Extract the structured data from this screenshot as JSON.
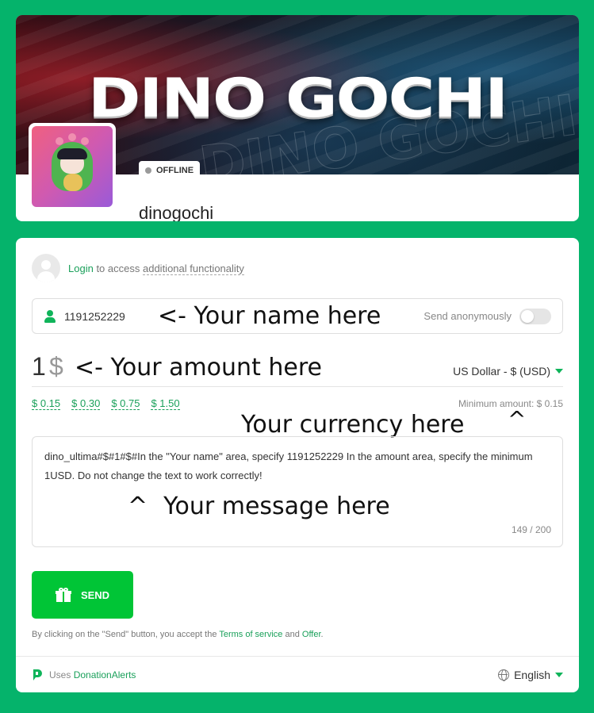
{
  "header": {
    "banner_title": "DINO GOCHI",
    "status": "OFFLINE",
    "streamer_name": "dinogochi"
  },
  "login": {
    "link_label": "Login",
    "suffix_plain": "to access",
    "suffix_dashed": "additional functionality"
  },
  "name_field": {
    "value": "1191252229",
    "send_anonymously_label": "Send anonymously",
    "send_anonymously_on": false
  },
  "amount": {
    "value": "1",
    "symbol": "$",
    "currency": "US Dollar - $ (USD)",
    "presets": [
      "$ 0.15",
      "$ 0.30",
      "$ 0.75",
      "$ 1.50"
    ],
    "minimum": "Minimum amount: $ 0.15"
  },
  "message": {
    "text": "dino_ultima#$#1#$#In the \"Your name\" area, specify 1191252229 In the amount area, specify the minimum 1USD. Do not change the text to work correctly!",
    "count": "149 / 200"
  },
  "annotations": {
    "name": "<- Your name here",
    "amount": "<- Your amount here",
    "currency": "Your currency here",
    "message": "Your message here",
    "caret": "^"
  },
  "send_button": {
    "label": "SEND"
  },
  "terms": {
    "prefix": "By clicking on the \"Send\" button, you accept the",
    "terms_link": "Terms of service",
    "and": "and",
    "offer_link": "Offer",
    "period": "."
  },
  "footer": {
    "uses": "Uses",
    "brand_link": "DonationAlerts",
    "language": "English"
  },
  "colors": {
    "page_bg": "#05b36b",
    "accent_green": "#1aa05a",
    "send_green": "#00c536"
  }
}
